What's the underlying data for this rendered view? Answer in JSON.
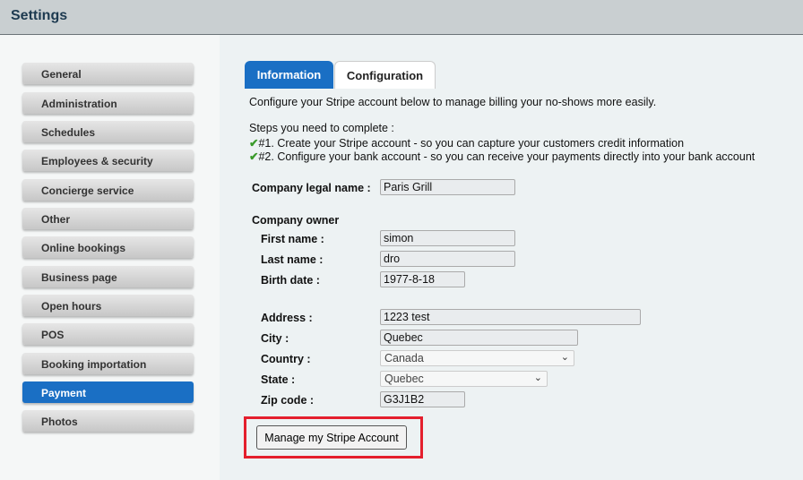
{
  "header": {
    "title": "Settings"
  },
  "sidebar": {
    "items": [
      {
        "label": "General"
      },
      {
        "label": "Administration"
      },
      {
        "label": "Schedules"
      },
      {
        "label": "Employees & security"
      },
      {
        "label": "Concierge service"
      },
      {
        "label": "Other"
      },
      {
        "label": "Online bookings"
      },
      {
        "label": "Business page"
      },
      {
        "label": "Open hours"
      },
      {
        "label": "POS"
      },
      {
        "label": "Booking importation"
      },
      {
        "label": "Payment",
        "active": true
      },
      {
        "label": "Photos"
      }
    ]
  },
  "tabs": [
    {
      "label": "Information",
      "active": true
    },
    {
      "label": "Configuration"
    }
  ],
  "intro": "Configure your Stripe account below to manage billing your no-shows more easily.",
  "steps_title": "Steps you need to complete :",
  "steps": [
    {
      "check": "✔",
      "text": "#1. Create your Stripe account - so you can capture your customers credit information"
    },
    {
      "check": "✔",
      "text": "#2. Configure your bank account - so you can receive your payments directly into your bank account"
    }
  ],
  "form": {
    "company_legal_name": {
      "label": "Company legal name :",
      "value": "Paris Grill"
    },
    "owner_heading": "Company owner",
    "first_name": {
      "label": "First name :",
      "value": "simon"
    },
    "last_name": {
      "label": "Last name :",
      "value": "dro"
    },
    "birth_date": {
      "label": "Birth date :",
      "value": "1977-8-18"
    },
    "address": {
      "label": "Address :",
      "value": "1223 test"
    },
    "city": {
      "label": "City :",
      "value": "Quebec"
    },
    "country": {
      "label": "Country :",
      "value": "Canada"
    },
    "state": {
      "label": "State :",
      "value": "Quebec"
    },
    "zip": {
      "label": "Zip code :",
      "value": "G3J1B2"
    }
  },
  "manage_button": "Manage my Stripe Account",
  "colors": {
    "accent": "#1a6fc4",
    "highlight": "#e41f2d",
    "check": "#3a9a2a"
  }
}
